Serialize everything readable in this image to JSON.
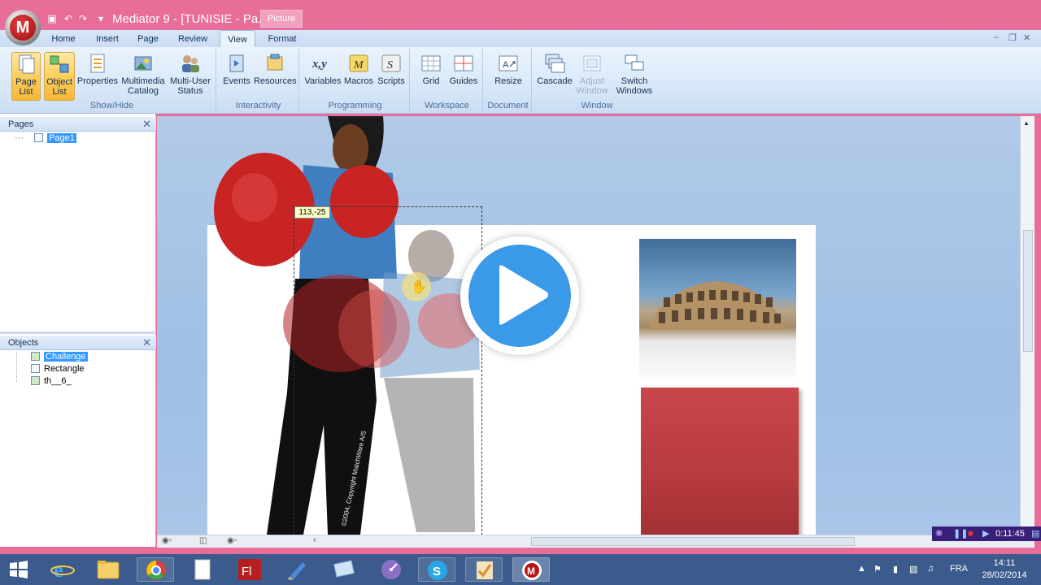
{
  "title_bar": {
    "window_title": "Mediator 9 - [TUNISIE - Pa...",
    "context_tab": "Picture",
    "logo_letter": "M"
  },
  "ribbon_tabs": [
    "Home",
    "Insert",
    "Page",
    "Review",
    "View",
    "Format"
  ],
  "active_tab": "View",
  "ribbon": {
    "show_hide": {
      "label": "Show/Hide",
      "page_list": "Page\nList",
      "object_list": "Object\nList",
      "properties": "Properties",
      "multimedia_catalog": "Multimedia\nCatalog",
      "multi_user_status": "Multi-User\nStatus"
    },
    "interactivity": {
      "label": "Interactivity",
      "events": "Events",
      "resources": "Resources"
    },
    "programming": {
      "label": "Programming",
      "variables": "Variables",
      "macros": "Macros",
      "scripts": "Scripts"
    },
    "workspace": {
      "label": "Workspace",
      "grid": "Grid",
      "guides": "Guides"
    },
    "document": {
      "label": "Document",
      "resize": "Resize"
    },
    "window": {
      "label": "Window",
      "cascade": "Cascade",
      "adjust_window": "Adjust\nWindow",
      "switch_windows": "Switch\nWindows"
    }
  },
  "pages_panel": {
    "title": "Pages",
    "items": [
      "Page1"
    ]
  },
  "objects_panel": {
    "title": "Objects",
    "items": [
      "Challenge",
      "Rectangle",
      "th__6_"
    ]
  },
  "canvas": {
    "coord_tooltip": "113,-25",
    "copyright_text": "©2004, Copyright MatchWare A/S"
  },
  "recorder": {
    "time": "0:11:45"
  },
  "taskbar": {
    "lang": "FRA",
    "time": "14:11",
    "date": "28/02/2014"
  },
  "colors": {
    "titlebar": "#e86e99",
    "taskbar": "#3a5b8c",
    "play_button": "#3b9ae8",
    "red_rect": "#c23a3a"
  }
}
